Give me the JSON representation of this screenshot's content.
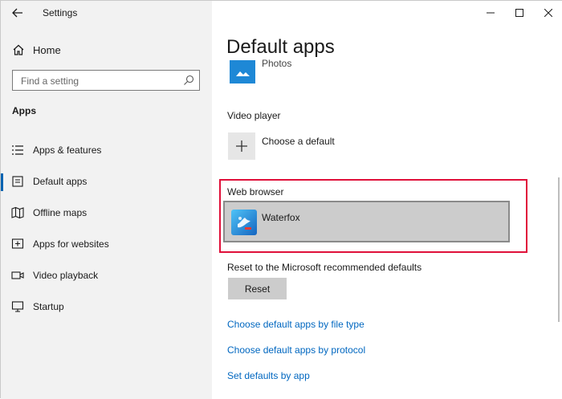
{
  "window": {
    "title": "Settings"
  },
  "sidebar": {
    "home_label": "Home",
    "search_placeholder": "Find a setting",
    "section_title": "Apps",
    "items": [
      {
        "label": "Apps & features",
        "icon": "list-icon",
        "active": false
      },
      {
        "label": "Default apps",
        "icon": "default-apps-icon",
        "active": true
      },
      {
        "label": "Offline maps",
        "icon": "map-icon",
        "active": false
      },
      {
        "label": "Apps for websites",
        "icon": "website-icon",
        "active": false
      },
      {
        "label": "Video playback",
        "icon": "video-icon",
        "active": false
      },
      {
        "label": "Startup",
        "icon": "startup-icon",
        "active": false
      }
    ]
  },
  "main": {
    "title": "Default apps",
    "photos_label": "Photos",
    "video_player": {
      "label": "Video player",
      "app": "Choose a default"
    },
    "web_browser": {
      "label": "Web browser",
      "app": "Waterfox"
    },
    "reset": {
      "label": "Reset to the Microsoft recommended defaults",
      "button": "Reset"
    },
    "links": [
      "Choose default apps by file type",
      "Choose default apps by protocol",
      "Set defaults by app"
    ]
  },
  "colors": {
    "accent": "#0063b1",
    "link": "#0067c0",
    "highlight_border": "#e0103a",
    "sidebar_bg": "#f2f2f2"
  }
}
